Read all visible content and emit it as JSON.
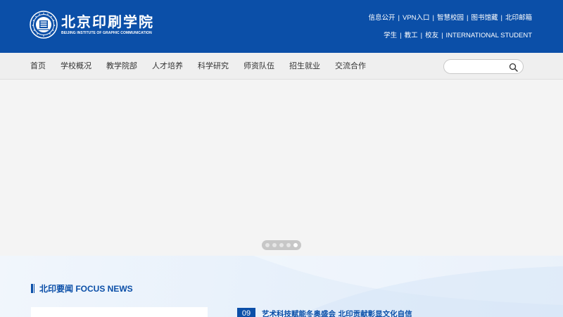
{
  "header": {
    "logo_cn": "北京印刷学院",
    "logo_en": "BEIJING INSTITUTE OF GRAPHIC COMMUNICATION",
    "links_row1": [
      "信息公开",
      "VPN入口",
      "智慧校园",
      "图书馆藏",
      "北印邮箱"
    ],
    "links_row2": [
      "学生",
      "教工",
      "校友",
      "INTERNATIONAL STUDENT"
    ],
    "separator": "|"
  },
  "nav": {
    "items": [
      "首页",
      "学校概况",
      "教学院部",
      "人才培养",
      "科学研究",
      "师资队伍",
      "招生就业",
      "交流合作"
    ]
  },
  "search": {
    "placeholder": "",
    "value": "",
    "icon": "search-icon"
  },
  "banner": {
    "slide_count": 5,
    "active_slide": 5
  },
  "news": {
    "section_title": "北印要闻 FOCUS NEWS",
    "items": [
      {
        "date": "09",
        "headline": "艺术科技赋能冬奥盛会 北印贡献彰显文化自信"
      }
    ]
  },
  "colors": {
    "brand_blue": "#0b4fa8",
    "nav_bg": "#efefef",
    "banner_bg": "#f4f4f4"
  }
}
